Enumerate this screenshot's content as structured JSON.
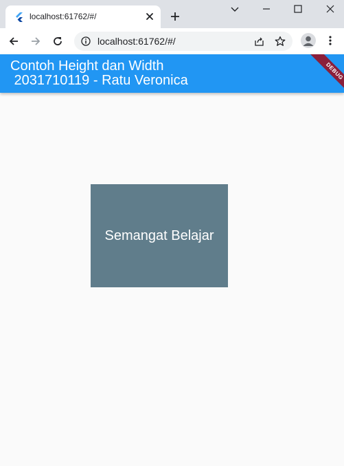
{
  "browser": {
    "tab_title": "localhost:61762/#/",
    "url": "localhost:61762/#/"
  },
  "app": {
    "title": "Contoh Height dan Width\n 2031710119 - Ratu Veronica",
    "debug_banner": "DEBUG",
    "appbar_color": "#2196f3",
    "box_color": "#607d8b",
    "box_text": "Semangat Belajar"
  }
}
